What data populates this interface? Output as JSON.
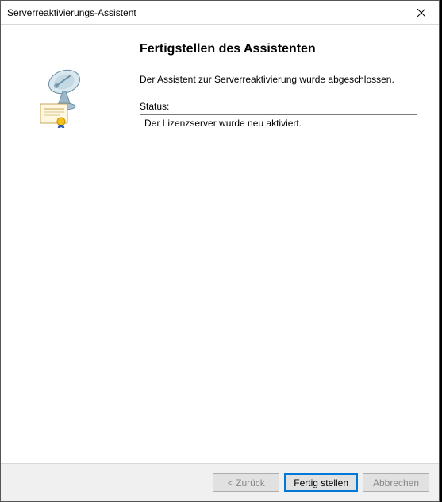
{
  "titlebar": {
    "title": "Serverreaktivierungs-Assistent",
    "close_icon": "close-icon"
  },
  "main": {
    "heading": "Fertigstellen des Assistenten",
    "description": "Der Assistent zur Serverreaktivierung wurde abgeschlossen.",
    "status_label": "Status:",
    "status_text": "Der Lizenzserver wurde neu aktiviert."
  },
  "footer": {
    "back_label": "< Zurück",
    "finish_label": "Fertig stellen",
    "cancel_label": "Abbrechen"
  }
}
